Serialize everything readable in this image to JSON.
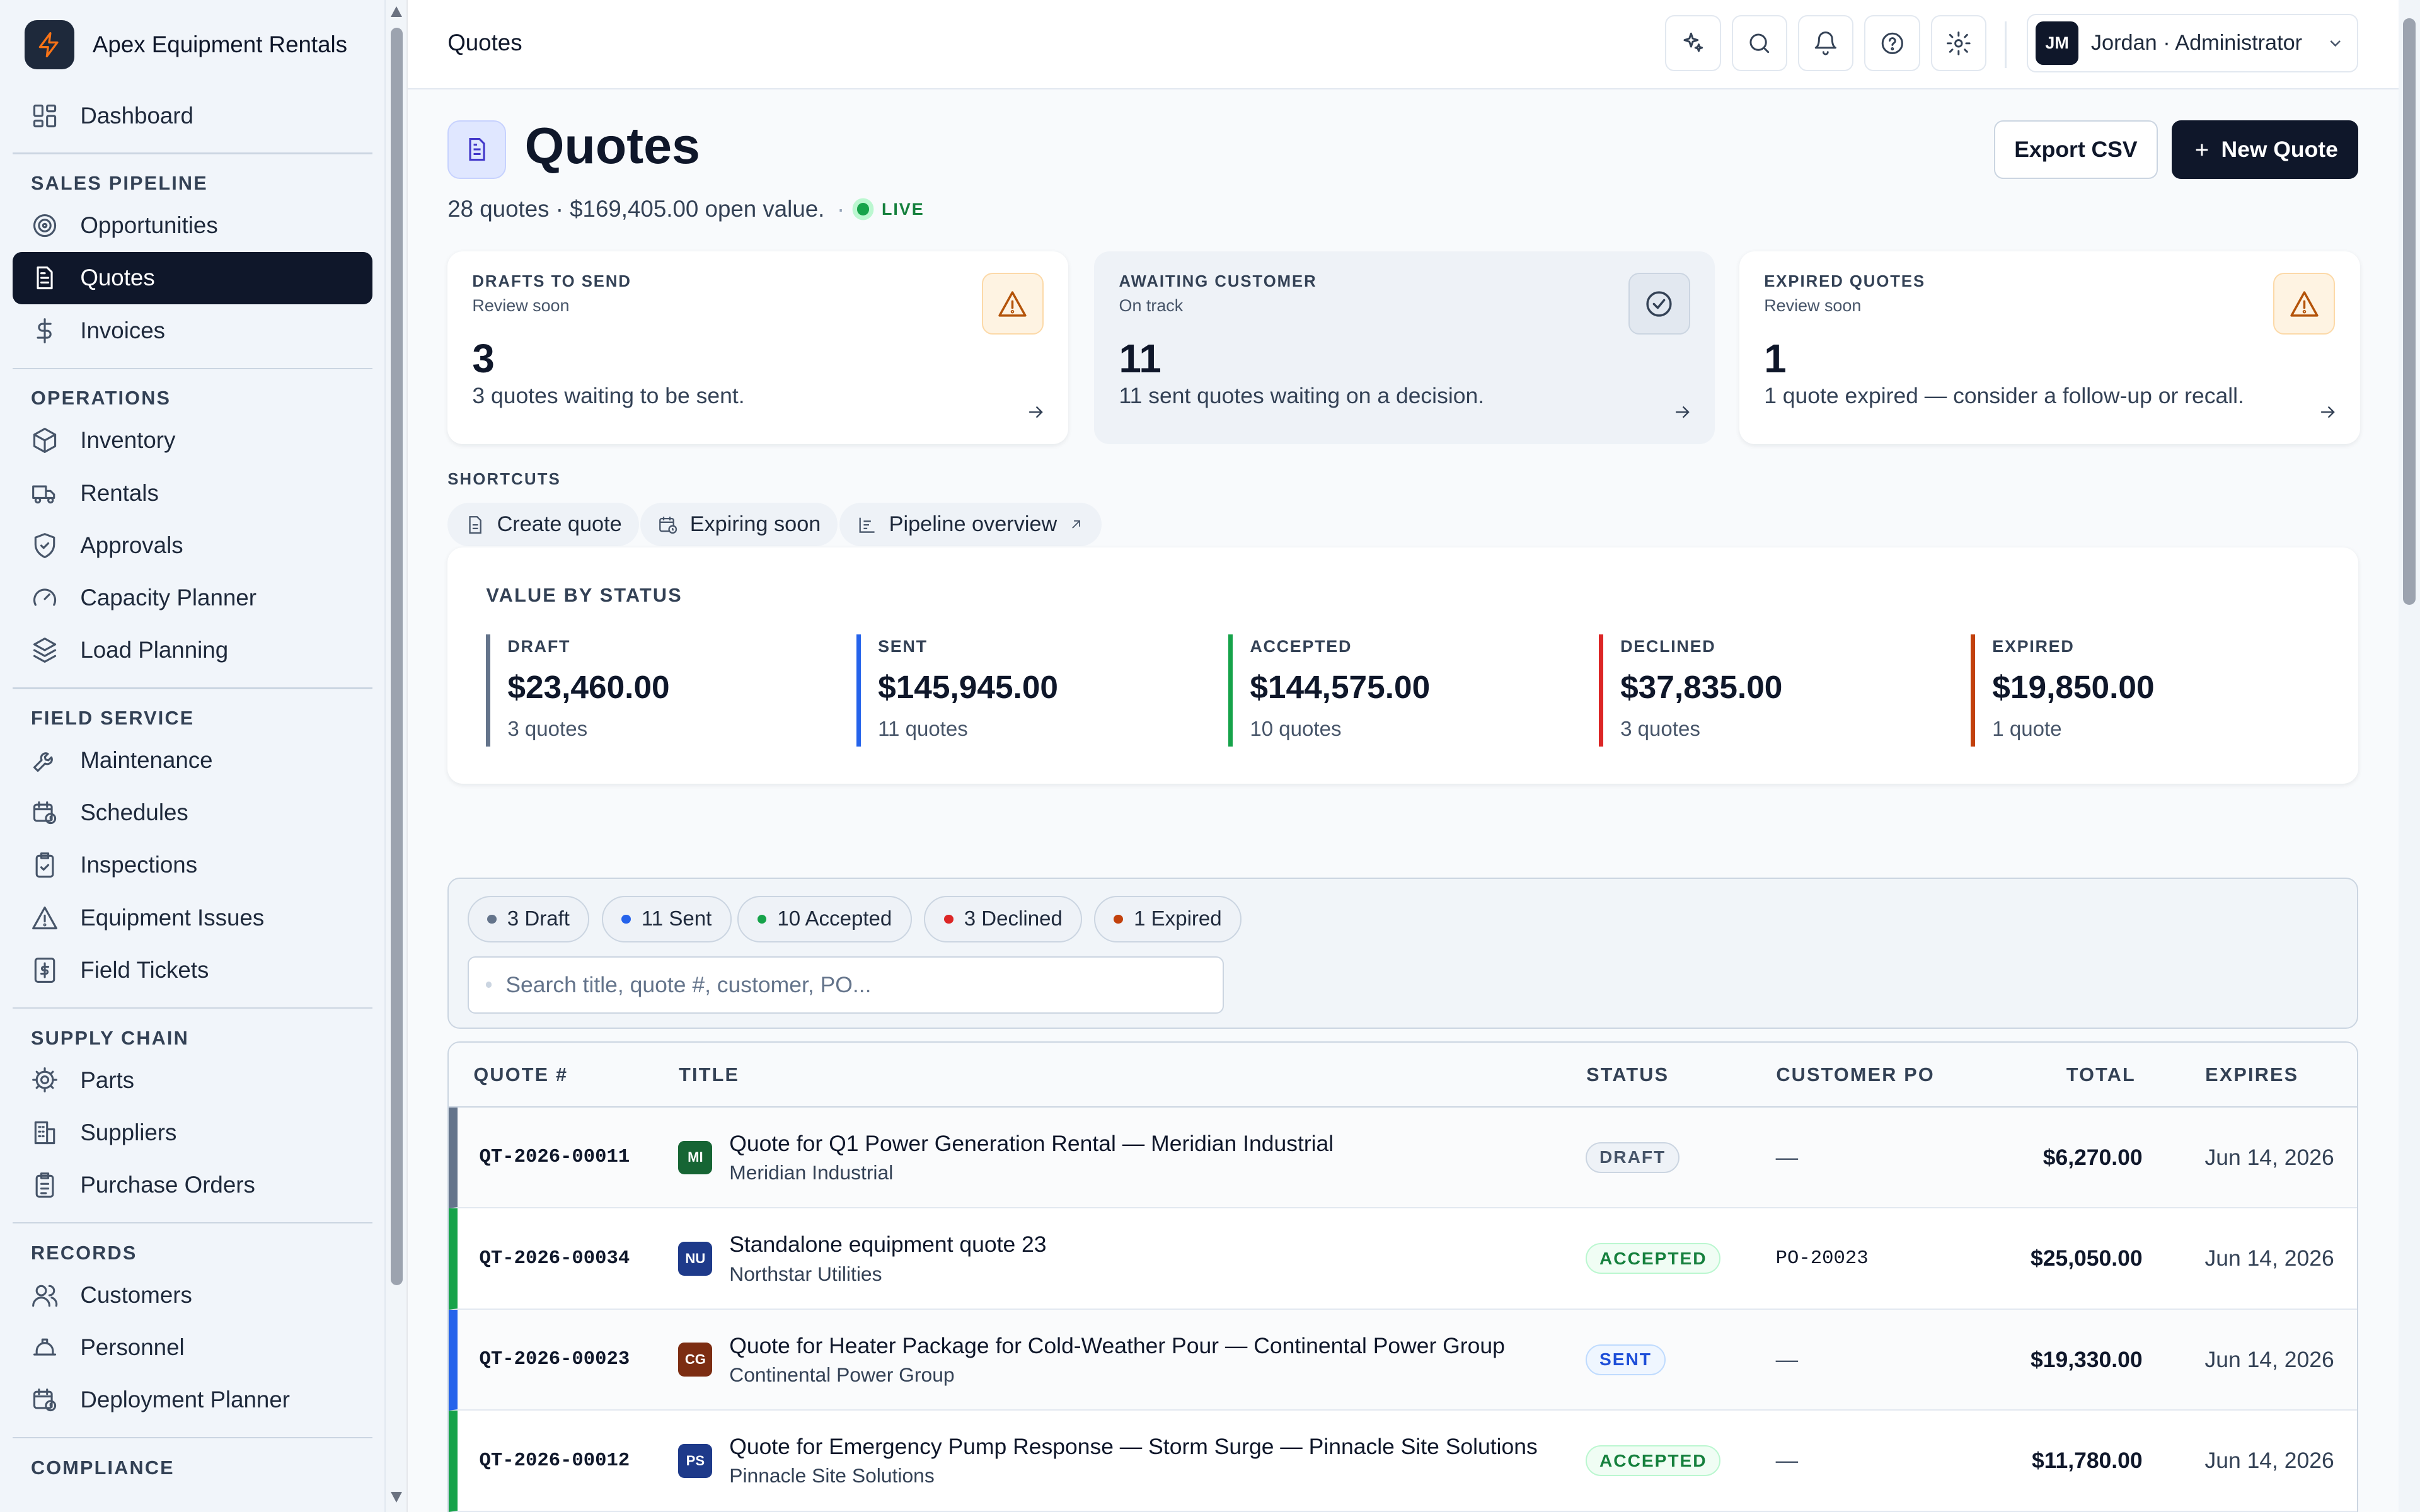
{
  "app": {
    "name": "Apex Equipment Rentals"
  },
  "sidebar": {
    "dashboard": "Dashboard",
    "sections": [
      {
        "title": "SALES PIPELINE",
        "items": [
          {
            "label": "Opportunities",
            "icon": "target-icon"
          },
          {
            "label": "Quotes",
            "icon": "document-icon",
            "active": true
          },
          {
            "label": "Invoices",
            "icon": "dollar-icon"
          }
        ]
      },
      {
        "title": "OPERATIONS",
        "items": [
          {
            "label": "Inventory",
            "icon": "box-icon"
          },
          {
            "label": "Rentals",
            "icon": "truck-icon"
          },
          {
            "label": "Approvals",
            "icon": "shield-check-icon"
          },
          {
            "label": "Capacity Planner",
            "icon": "gauge-icon"
          },
          {
            "label": "Load Planning",
            "icon": "layers-icon"
          }
        ]
      },
      {
        "title": "FIELD SERVICE",
        "items": [
          {
            "label": "Maintenance",
            "icon": "wrench-icon"
          },
          {
            "label": "Schedules",
            "icon": "calendar-clock-icon"
          },
          {
            "label": "Inspections",
            "icon": "clipboard-check-icon"
          },
          {
            "label": "Equipment Issues",
            "icon": "warning-icon"
          },
          {
            "label": "Field Tickets",
            "icon": "receipt-icon"
          }
        ]
      },
      {
        "title": "SUPPLY CHAIN",
        "items": [
          {
            "label": "Parts",
            "icon": "cog-icon"
          },
          {
            "label": "Suppliers",
            "icon": "building-icon"
          },
          {
            "label": "Purchase Orders",
            "icon": "clipboard-list-icon"
          }
        ]
      },
      {
        "title": "RECORDS",
        "items": [
          {
            "label": "Customers",
            "icon": "users-icon"
          },
          {
            "label": "Personnel",
            "icon": "hard-hat-icon"
          },
          {
            "label": "Deployment Planner",
            "icon": "calendar-clock-icon"
          }
        ]
      },
      {
        "title": "COMPLIANCE",
        "items": []
      }
    ]
  },
  "topbar": {
    "title": "Quotes",
    "user": "Jordan · Administrator",
    "user_initials": "JM"
  },
  "header": {
    "title": "Quotes",
    "subtitle": "28 quotes · $169,405.00 open value.",
    "live": "LIVE",
    "export": "Export CSV",
    "new_quote": "New Quote"
  },
  "kpis": [
    {
      "label": "DRAFTS TO SEND",
      "hint": "Review soon",
      "value": "3",
      "desc": "3 quotes waiting to be sent.",
      "icon": "warning-icon",
      "tone": "warn"
    },
    {
      "label": "AWAITING CUSTOMER",
      "hint": "On track",
      "value": "11",
      "desc": "11 sent quotes waiting on a decision.",
      "icon": "check-circle-icon",
      "tone": "ok"
    },
    {
      "label": "EXPIRED QUOTES",
      "hint": "Review soon",
      "value": "1",
      "desc": "1 quote expired — consider a follow-up or recall.",
      "icon": "warning-icon",
      "tone": "warn"
    }
  ],
  "shortcuts": {
    "label": "SHORTCUTS",
    "items": [
      "Create quote",
      "Expiring soon",
      "Pipeline overview"
    ]
  },
  "value_by_status": {
    "title": "VALUE BY STATUS",
    "items": [
      {
        "label": "DRAFT",
        "value": "$23,460.00",
        "count": "3 quotes",
        "color": "#64748b"
      },
      {
        "label": "SENT",
        "value": "$145,945.00",
        "count": "11 quotes",
        "color": "#2563eb"
      },
      {
        "label": "ACCEPTED",
        "value": "$144,575.00",
        "count": "10 quotes",
        "color": "#16a34a"
      },
      {
        "label": "DECLINED",
        "value": "$37,835.00",
        "count": "3 quotes",
        "color": "#dc2626"
      },
      {
        "label": "EXPIRED",
        "value": "$19,850.00",
        "count": "1 quote",
        "color": "#c2410c"
      }
    ]
  },
  "filters": {
    "pills": [
      {
        "label": "3 Draft",
        "color": "#64748b"
      },
      {
        "label": "11 Sent",
        "color": "#2563eb"
      },
      {
        "label": "10 Accepted",
        "color": "#16a34a"
      },
      {
        "label": "3 Declined",
        "color": "#dc2626"
      },
      {
        "label": "1 Expired",
        "color": "#c2410c"
      }
    ],
    "search_placeholder": "Search title, quote #, customer, PO..."
  },
  "table": {
    "columns": [
      "QUOTE #",
      "TITLE",
      "STATUS",
      "CUSTOMER PO",
      "TOTAL",
      "EXPIRES"
    ],
    "rows": [
      {
        "id": "QT-2026-00011",
        "title": "Quote for Q1 Power Generation Rental — Meridian Industrial",
        "customer": "Meridian Industrial",
        "initials": "MI",
        "logo_color": "#166534",
        "status": "DRAFT",
        "status_class": "b-draft",
        "stripe": "#64748b",
        "po": "—",
        "total": "$6,270.00",
        "expires": "Jun 14, 2026"
      },
      {
        "id": "QT-2026-00034",
        "title": "Standalone equipment quote 23",
        "customer": "Northstar Utilities",
        "initials": "NU",
        "logo_color": "#1e3a8a",
        "status": "ACCEPTED",
        "status_class": "b-accepted",
        "stripe": "#16a34a",
        "po": "PO-20023",
        "total": "$25,050.00",
        "expires": "Jun 14, 2026"
      },
      {
        "id": "QT-2026-00023",
        "title": "Quote for Heater Package for Cold-Weather Pour — Continental Power Group",
        "customer": "Continental Power Group",
        "initials": "CG",
        "logo_color": "#7c2d12",
        "status": "SENT",
        "status_class": "b-sent",
        "stripe": "#2563eb",
        "po": "—",
        "total": "$19,330.00",
        "expires": "Jun 14, 2026"
      },
      {
        "id": "QT-2026-00012",
        "title": "Quote for Emergency Pump Response — Storm Surge — Pinnacle Site Solutions",
        "customer": "Pinnacle Site Solutions",
        "initials": "PS",
        "logo_color": "#1e3a8a",
        "status": "ACCEPTED",
        "status_class": "b-accepted",
        "stripe": "#16a34a",
        "po": "—",
        "total": "$11,780.00",
        "expires": "Jun 14, 2026"
      }
    ]
  }
}
